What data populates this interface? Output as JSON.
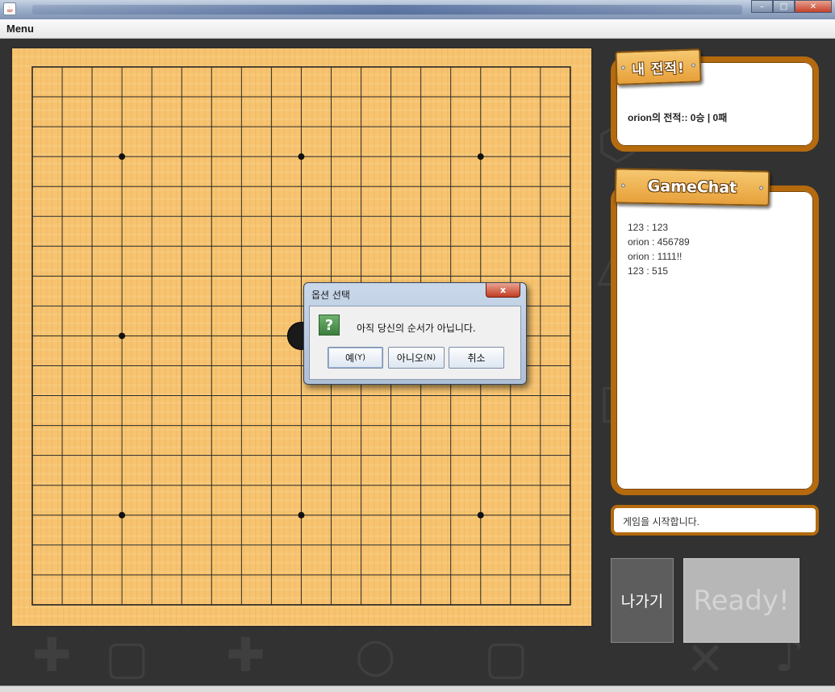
{
  "window": {
    "close_glyph": "✕",
    "minimize_glyph": "–",
    "maximize_glyph": "□"
  },
  "menubar": {
    "menu_label": "Menu"
  },
  "board": {
    "grid_lines": 19,
    "star_points": [
      [
        3,
        3
      ],
      [
        3,
        9
      ],
      [
        3,
        15
      ],
      [
        9,
        3
      ],
      [
        15,
        3
      ],
      [
        15,
        9
      ],
      [
        15,
        15
      ],
      [
        9,
        15
      ]
    ],
    "stones": [
      {
        "col": 9,
        "row": 9,
        "color": "black"
      }
    ]
  },
  "record_panel": {
    "sign_label": "내 전적!",
    "record_text": "orion의 전적:: 0승 | 0패"
  },
  "chat_panel": {
    "sign_label": "GameChat",
    "messages": [
      {
        "text": "123 : 123"
      },
      {
        "text": "orion : 456789"
      },
      {
        "text": "orion : 1111!!"
      },
      {
        "text": "123 : 515"
      }
    ]
  },
  "chat_input": {
    "value": "게임을 시작합니다."
  },
  "buttons": {
    "exit_label": "나가기",
    "ready_label": "Ready!"
  },
  "dialog": {
    "title": "옵션 선택",
    "icon_glyph": "?",
    "message": "아직 당신의 순서가 아닙니다.",
    "close_glyph": "x",
    "yes_label": "예",
    "yes_mnemonic": "(Y)",
    "no_label": "아니오",
    "no_mnemonic": "(N)",
    "cancel_label": "취소"
  },
  "colors": {
    "board": "#f7c36f",
    "panel_border": "#b46a0d",
    "background": "#323232"
  }
}
